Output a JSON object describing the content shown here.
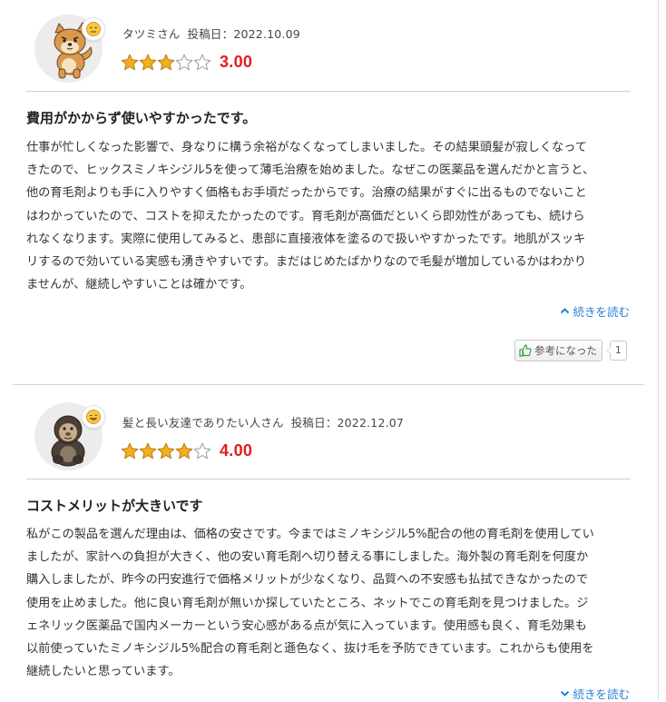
{
  "reviews": [
    {
      "avatar_icon": "shiba-dog-avatar-icon",
      "mood_icon": "neutral-face-icon",
      "reviewer": "タツミさん",
      "date_label": "投稿日：",
      "date": "2022.10.09",
      "rating": 3,
      "rating_max": 5,
      "score": "3.00",
      "title": "費用がかからず使いやすかったです。",
      "body": [
        "仕事が忙しくなった影響で、身なりに構う余裕がなくなってしまいました。その結果頭髪が寂しくなって",
        "きたので、ヒックスミノキシジル5を使って薄毛治療を始めました。なぜこの医薬品を選んだかと言うと、",
        "他の育毛剤よりも手に入りやすく価格もお手頃だったからです。治療の結果がすぐに出るものでないこと",
        "はわかっていたので、コストを抑えたかったのです。育毛剤が高価だといくら即効性があっても、続けら",
        "れなくなります。実際に使用してみると、患部に直接液体を塗るので扱いやすかったです。地肌がスッキ",
        "リするので効いている実感も湧きやすいです。まだはじめたばかりなので毛髪が増加しているかはわかり",
        "ませんが、継続しやすいことは確かです。"
      ],
      "readmore_label": "続きを読む",
      "readmore_state": "expanded",
      "helpful_label": "参考になった",
      "helpful_count": "1"
    },
    {
      "avatar_icon": "gorilla-avatar-icon",
      "mood_icon": "happy-face-icon",
      "reviewer": "髪と長い友達でありたい人さん",
      "date_label": "投稿日：",
      "date": "2022.12.07",
      "rating": 4,
      "rating_max": 5,
      "score": "4.00",
      "title": "コストメリットが大きいです",
      "body": [
        "私がこの製品を選んだ理由は、価格の安さです。今まではミノキシジル5%配合の他の育毛剤を使用してい",
        "ましたが、家計への負担が大きく、他の安い育毛剤へ切り替える事にしました。海外製の育毛剤を何度か",
        "購入しましたが、昨今の円安進行で価格メリットが少なくなり、品質への不安感も払拭できなかったので",
        "使用を止めました。他に良い育毛剤が無いか探していたところ、ネットでこの育毛剤を見つけました。ジ",
        "ェネリック医薬品で国内メーカーという安心感がある点が気に入っています。使用感も良く、育毛効果も",
        "以前使っていたミノキシジル5%配合の育毛剤と遜色なく、抜け毛を予防できています。これからも使用を",
        "継続したいと思っています。"
      ],
      "readmore_label": "続きを読む",
      "readmore_state": "collapsed"
    }
  ],
  "colors": {
    "score_red": "#e41c1c",
    "star_gold": "#f2b01e",
    "link_blue": "#2a7fd4",
    "thumb_green": "#3aa53a"
  }
}
